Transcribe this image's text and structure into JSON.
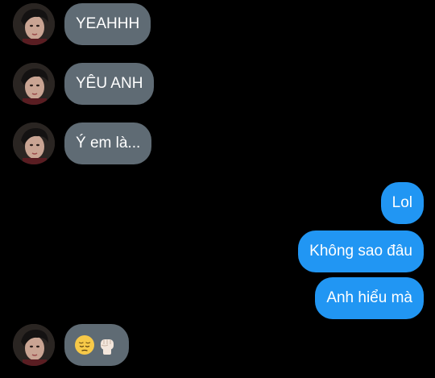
{
  "messages": [
    {
      "side": "in",
      "text": "YEAHHH"
    },
    {
      "side": "in",
      "text": "YÊU ANH"
    },
    {
      "side": "in",
      "text": "Ý em là..."
    },
    {
      "side": "out",
      "text": "Lol"
    },
    {
      "side": "out",
      "text": "Không sao đâu"
    },
    {
      "side": "out",
      "text": "Anh hiểu mà"
    },
    {
      "side": "in",
      "text": "",
      "emojis": [
        "pensive-face-emoji",
        "raised-fist-emoji"
      ]
    }
  ],
  "colors": {
    "background": "#000000",
    "incoming_bubble": "#5f6b74",
    "outgoing_bubble": "#2196f3",
    "text": "#ffffff"
  }
}
